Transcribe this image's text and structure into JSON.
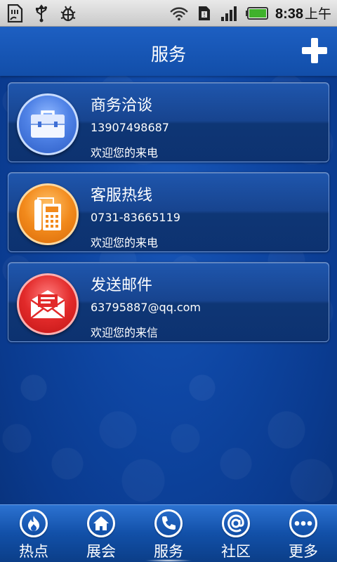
{
  "status_bar": {
    "time": "8:38",
    "ampm": "上午",
    "icons": [
      "sd-card-icon",
      "usb-icon",
      "android-debug-icon",
      "wifi-icon",
      "sim-icon",
      "signal-icon",
      "battery-icon"
    ]
  },
  "header": {
    "title": "服务",
    "add_icon": "plus-icon"
  },
  "cards": [
    {
      "title": "商务洽谈",
      "line1": "13907498687",
      "line2": "欢迎您的来电",
      "icon": "briefcase-icon",
      "color": "#4f82e6"
    },
    {
      "title": "客服热线",
      "line1": "0731-83665119",
      "line2": "欢迎您的来电",
      "icon": "telephone-icon",
      "color": "#f28a1c"
    },
    {
      "title": "发送邮件",
      "line1": "63795887@qq.com",
      "line2": "欢迎您的来信",
      "icon": "mail-icon",
      "color": "#e22a2a"
    }
  ],
  "bottom_nav": {
    "items": [
      {
        "label": "热点",
        "icon": "flame-icon"
      },
      {
        "label": "展会",
        "icon": "home-icon"
      },
      {
        "label": "服务",
        "icon": "phone-icon",
        "active": true
      },
      {
        "label": "社区",
        "icon": "at-icon"
      },
      {
        "label": "更多",
        "icon": "more-icon"
      }
    ]
  },
  "colors": {
    "background": "#0e46a3",
    "title_bar": "#1857b8",
    "text": "#ffffff"
  }
}
